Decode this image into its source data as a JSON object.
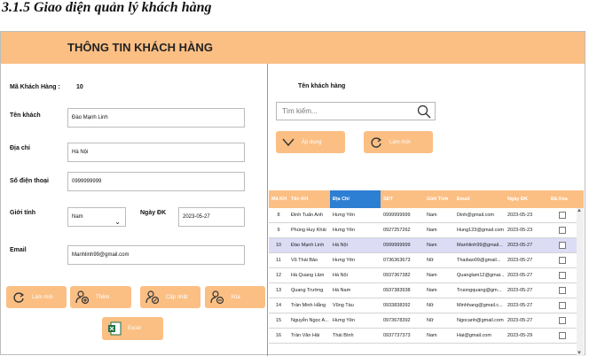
{
  "doc_heading": "3.1.5 Giao diện quản lý khách hàng",
  "title": "THÔNG TIN KHÁCH HÀNG",
  "form": {
    "ma_label": "Mã Khách Hàng :",
    "ma_value": "10",
    "ten_label": "Tên khách",
    "ten_value": "Đào Mạnh Linh",
    "diachi_label": "Địa chỉ",
    "diachi_value": "Hà Nội",
    "sdt_label": "Số điện thoại",
    "sdt_value": "0999999999",
    "gioitinh_label": "Giới tính",
    "gioitinh_value": "Nam",
    "ngaydk_label": "Ngày ĐK",
    "ngaydk_value": "2023-05-27",
    "email_label": "Email",
    "email_value": "Manhlinh99@gmail.com"
  },
  "buttons": {
    "lammoi": "Làm mới",
    "them": "Thêm",
    "capnhat": "Cập nhật",
    "xoa": "Xóa",
    "excel": "Excel",
    "apdung": "Áp dụng",
    "lammoi2": "Làm mới"
  },
  "search": {
    "label": "Tên khách hàng",
    "placeholder": "Tìm kiếm..."
  },
  "table": {
    "headers": [
      "Mã KH",
      "Tên KH",
      "Địa Chỉ",
      "SĐT",
      "Giới Tính",
      "Email",
      "Ngày ĐK",
      "Đã Xóa"
    ],
    "rows": [
      [
        "8",
        "Đinh Tuấn Anh",
        "Hưng Yên",
        "0999999999",
        "Nam",
        "Dinh@gmail.com",
        "2023-05-23"
      ],
      [
        "9",
        "Phùng Huy Khải",
        "Hưng Yên",
        "0927257262",
        "Nam",
        "Hung123@gmail.com",
        "2023-05-23"
      ],
      [
        "10",
        "Đào Mạnh Linh",
        "Hà Nội",
        "0999999999",
        "Nam",
        "Manhlinh99@gmail...",
        "2023-05-27"
      ],
      [
        "11",
        "Vũ Thái Bảo",
        "Hưng Yên",
        "0736363673",
        "Nữ",
        "Thaibao09@gmail...",
        "2023-05-27"
      ],
      [
        "12",
        "Hà Quang Lâm",
        "Hà Nội",
        "0937367382",
        "Nam",
        "Quanglam12@gmai...",
        "2023-05-27"
      ],
      [
        "13",
        "Quang Trường",
        "Hà Nam",
        "0937383938",
        "Nam",
        "Truongquang@gm...",
        "2023-05-27"
      ],
      [
        "14",
        "Trần Minh Hằng",
        "Vũng Tàu",
        "0933838392",
        "Nữ",
        "Minhhang@gmail.c...",
        "2023-05-27"
      ],
      [
        "15",
        "Nguyễn Ngọc A...",
        "Hưng Yên",
        "0973678392",
        "Nữ",
        "Ngocanh@gmail.com",
        "2023-05-27"
      ],
      [
        "16",
        "Trần Văn Hải",
        "Thái Bình",
        "0937737373",
        "Nam",
        "Hai@gmail.com",
        "2023-05-29"
      ]
    ],
    "selected_row": 2,
    "selected_header": 2
  },
  "colors": {
    "accent": "#fbbf84",
    "header_selected": "#2d7fd3",
    "row_highlight": "#dcdcf5"
  }
}
